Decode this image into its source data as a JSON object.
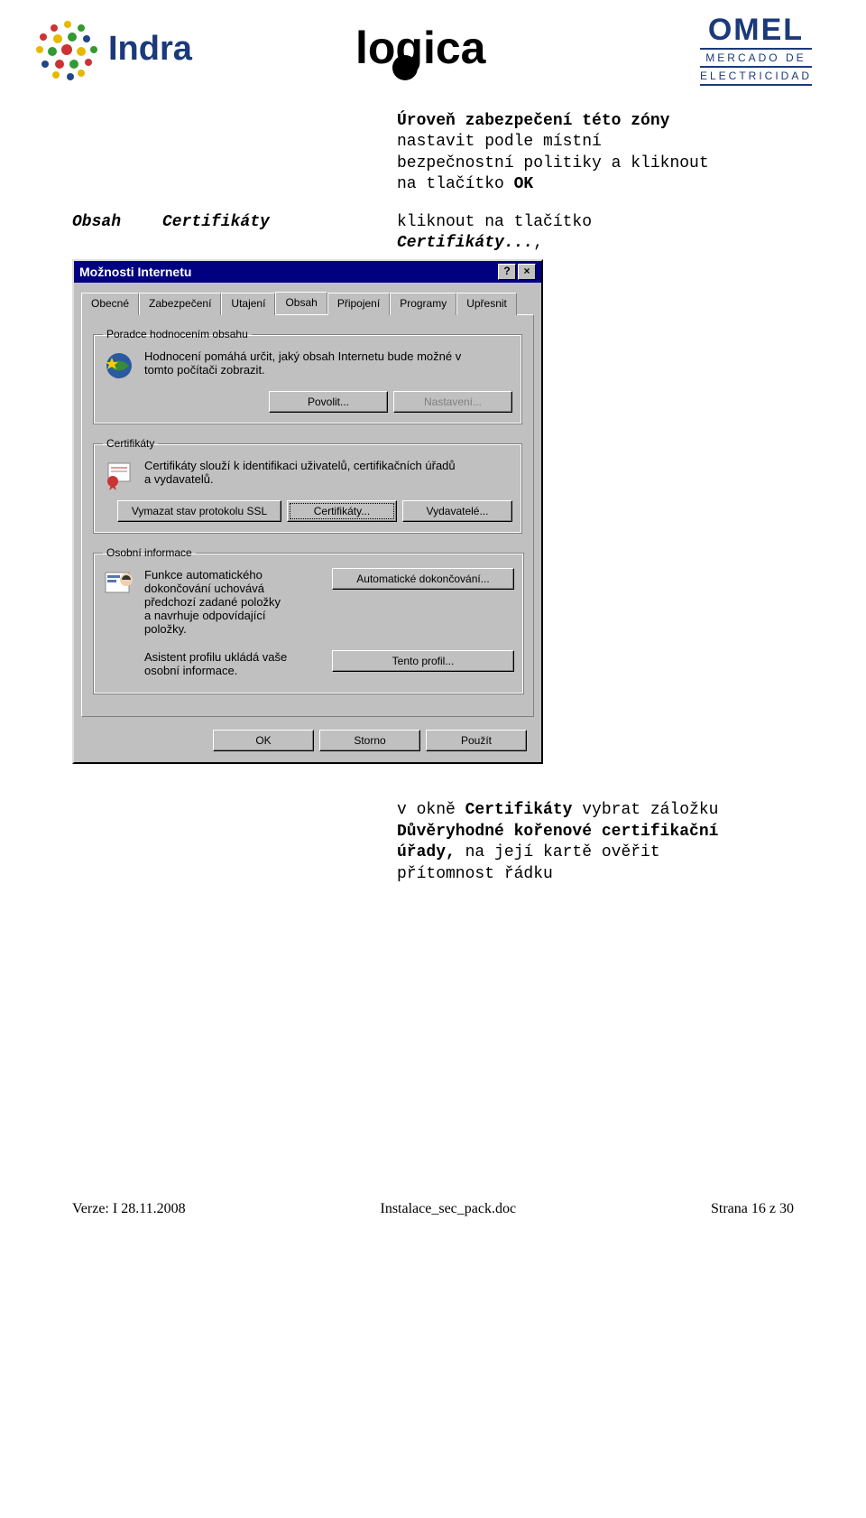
{
  "logos": {
    "indra": "Indra",
    "logica": "logica",
    "omel_main": "OMEL",
    "omel_sub1": "MERCADO DE",
    "omel_sub2": "ELECTRICIDAD"
  },
  "para1": {
    "l1": "Úroveň zabezpečení této zóny",
    "l2": "nastavit podle místní",
    "l3": "bezpečnostní politiky a kliknout",
    "l4": "na tlačítko ",
    "l4b": "OK"
  },
  "row2": {
    "left": "Obsah",
    "mid": "Certifikáty",
    "right1": "kliknout na tlačítko",
    "right2": "Certifikáty...",
    "right2b": ","
  },
  "dialog": {
    "title": "Možnosti Internetu",
    "help": "?",
    "close": "×",
    "tabs": [
      "Obecné",
      "Zabezpečení",
      "Utajení",
      "Obsah",
      "Připojení",
      "Programy",
      "Upřesnit"
    ],
    "group_rating": {
      "legend": "Poradce hodnocením obsahu",
      "text1": "Hodnocení pomáhá určit, jaký obsah Internetu bude možné v",
      "text2": "tomto počítači zobrazit.",
      "btn_enable": "Povolit...",
      "btn_settings": "Nastavení..."
    },
    "group_cert": {
      "legend": "Certifikáty",
      "text1": "Certifikáty slouží k identifikaci uživatelů, certifikačních úřadů",
      "text2": "a vydavatelů.",
      "btn_clear": "Vymazat stav protokolu SSL",
      "btn_cert": "Certifikáty...",
      "btn_pub": "Vydavatelé..."
    },
    "group_personal": {
      "legend": "Osobní informace",
      "auto_l1": "Funkce automatického",
      "auto_l2": "dokončování uchovává",
      "auto_l3": "předchozí zadané položky",
      "auto_l4": "a navrhuje odpovídající",
      "auto_l5": "položky.",
      "btn_auto": "Automatické dokončování...",
      "profile_l1": "Asistent profilu ukládá vaše",
      "profile_l2": "osobní informace.",
      "btn_profile": "Tento profil..."
    },
    "btn_ok": "OK",
    "btn_cancel": "Storno",
    "btn_apply": "Použít"
  },
  "para3": {
    "l1_a": "v okně ",
    "l1_b": "Certifikáty",
    "l1_c": " vybrat záložku",
    "l2": "Důvěryhodné kořenové certifikační",
    "l3_a": "úřady,",
    "l3_b": " na její kartě ověřit",
    "l4": "přítomnost řádku"
  },
  "footer": {
    "left": "Verze: I   28.11.2008",
    "center": "Instalace_sec_pack.doc",
    "right": "Strana 16 z 30"
  }
}
